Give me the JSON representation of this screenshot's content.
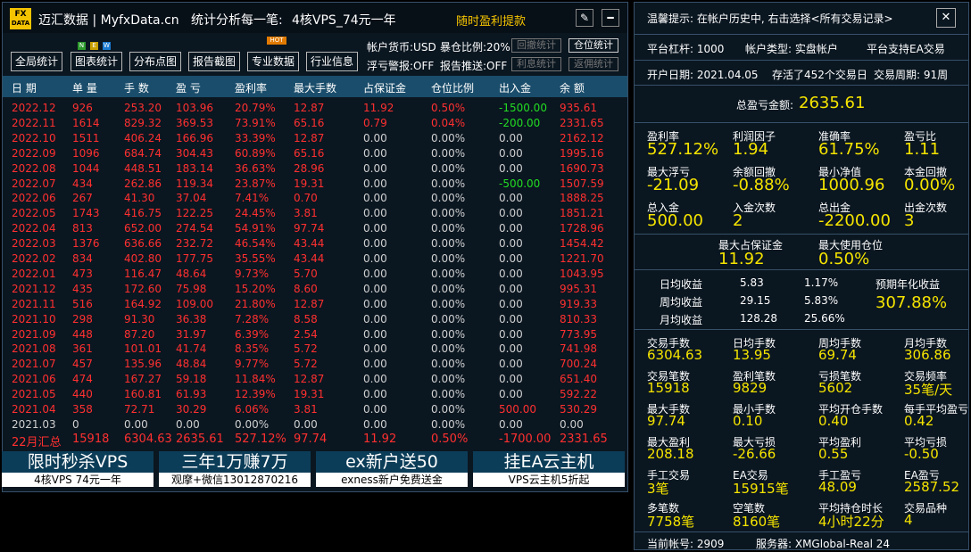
{
  "header": {
    "logo_top": "FX",
    "logo_bottom": "DATA",
    "title": "迈汇数据 | MyfxData.cn",
    "subtitle": "统计分析每一笔:",
    "vps": "4核VPS_74元一年",
    "promo": "随时盈利提款",
    "min_icon": "pen-icon",
    "max_icon": "minus-icon"
  },
  "toolbar": {
    "buttons": [
      "全局统计",
      "图表统计",
      "分布点图",
      "报告截图",
      "专业数据",
      "行业信息"
    ],
    "badge_new": [
      "N",
      "E",
      "W"
    ],
    "badge_hot": "HOT",
    "info_currency": "帐户货币:USD",
    "info_leverage": "暴仓比例:20%",
    "info_float": "浮亏警报:OFF",
    "info_push": "报告推送:OFF",
    "btn_drawdown": "回撤统计",
    "btn_position": "仓位统计",
    "btn_interest": "利息统计",
    "btn_rebate": "返佣统计"
  },
  "table": {
    "columns": [
      "日 期",
      "单 量",
      "手 数",
      "盈 亏",
      "盈利率",
      "最大手数",
      "占保证金",
      "仓位比例",
      "出入金",
      "余 额"
    ],
    "rows": [
      [
        "2022.12",
        "926",
        "253.20",
        "103.96",
        "20.79%",
        "12.87",
        "11.92",
        "0.50%",
        "-1500.00",
        "935.61"
      ],
      [
        "2022.11",
        "1614",
        "829.32",
        "369.53",
        "73.91%",
        "65.16",
        "0.79",
        "0.04%",
        "-200.00",
        "2331.65"
      ],
      [
        "2022.10",
        "1511",
        "406.24",
        "166.96",
        "33.39%",
        "12.87",
        "0.00",
        "0.00%",
        "0.00",
        "2162.12"
      ],
      [
        "2022.09",
        "1096",
        "684.74",
        "304.43",
        "60.89%",
        "65.16",
        "0.00",
        "0.00%",
        "0.00",
        "1995.16"
      ],
      [
        "2022.08",
        "1044",
        "448.51",
        "183.14",
        "36.63%",
        "28.96",
        "0.00",
        "0.00%",
        "0.00",
        "1690.73"
      ],
      [
        "2022.07",
        "434",
        "262.86",
        "119.34",
        "23.87%",
        "19.31",
        "0.00",
        "0.00%",
        "-500.00",
        "1507.59"
      ],
      [
        "2022.06",
        "267",
        "41.30",
        "37.04",
        "7.41%",
        "0.70",
        "0.00",
        "0.00%",
        "0.00",
        "1888.25"
      ],
      [
        "2022.05",
        "1743",
        "416.75",
        "122.25",
        "24.45%",
        "3.81",
        "0.00",
        "0.00%",
        "0.00",
        "1851.21"
      ],
      [
        "2022.04",
        "813",
        "652.00",
        "274.54",
        "54.91%",
        "97.74",
        "0.00",
        "0.00%",
        "0.00",
        "1728.96"
      ],
      [
        "2022.03",
        "1376",
        "636.66",
        "232.72",
        "46.54%",
        "43.44",
        "0.00",
        "0.00%",
        "0.00",
        "1454.42"
      ],
      [
        "2022.02",
        "834",
        "402.80",
        "177.75",
        "35.55%",
        "43.44",
        "0.00",
        "0.00%",
        "0.00",
        "1221.70"
      ],
      [
        "2022.01",
        "473",
        "116.47",
        "48.64",
        "9.73%",
        "5.70",
        "0.00",
        "0.00%",
        "0.00",
        "1043.95"
      ],
      [
        "2021.12",
        "435",
        "172.60",
        "75.98",
        "15.20%",
        "8.60",
        "0.00",
        "0.00%",
        "0.00",
        "995.31"
      ],
      [
        "2021.11",
        "516",
        "164.92",
        "109.00",
        "21.80%",
        "12.87",
        "0.00",
        "0.00%",
        "0.00",
        "919.33"
      ],
      [
        "2021.10",
        "298",
        "91.30",
        "36.38",
        "7.28%",
        "8.58",
        "0.00",
        "0.00%",
        "0.00",
        "810.33"
      ],
      [
        "2021.09",
        "448",
        "87.20",
        "31.97",
        "6.39%",
        "2.54",
        "0.00",
        "0.00%",
        "0.00",
        "773.95"
      ],
      [
        "2021.08",
        "361",
        "101.01",
        "41.74",
        "8.35%",
        "5.72",
        "0.00",
        "0.00%",
        "0.00",
        "741.98"
      ],
      [
        "2021.07",
        "457",
        "135.96",
        "48.84",
        "9.77%",
        "5.72",
        "0.00",
        "0.00%",
        "0.00",
        "700.24"
      ],
      [
        "2021.06",
        "474",
        "167.27",
        "59.18",
        "11.84%",
        "12.87",
        "0.00",
        "0.00%",
        "0.00",
        "651.40"
      ],
      [
        "2021.05",
        "440",
        "160.81",
        "61.93",
        "12.39%",
        "19.31",
        "0.00",
        "0.00%",
        "0.00",
        "592.22"
      ],
      [
        "2021.04",
        "358",
        "72.71",
        "30.29",
        "6.06%",
        "3.81",
        "0.00",
        "0.00%",
        "500.00",
        "530.29"
      ],
      [
        "2021.03",
        "0",
        "0.00",
        "0.00",
        "0.00%",
        "0.00",
        "0.00",
        "0.00%",
        "0.00",
        "0.00"
      ]
    ],
    "summary": [
      "22月汇总",
      "15918",
      "6304.63",
      "2635.61",
      "527.12%",
      "97.74",
      "11.92",
      "0.50%",
      "-1700.00",
      "2331.65"
    ],
    "colors": {
      "row": "#ff3030",
      "zero_row": "#d0d0d0",
      "neg_cash": "#22dd22",
      "pos_cash": "#ff3030"
    }
  },
  "banners": [
    {
      "big": "限时秒杀VPS",
      "small": "4核VPS  74元一年"
    },
    {
      "big": "三年1万赚7万",
      "small": "观摩+微信13012870216"
    },
    {
      "big": "ex新户送50",
      "small": "exness新户免费送金"
    },
    {
      "big": "挂EA云主机",
      "small": "VPS云主机5折起"
    }
  ],
  "panel": {
    "tip": "温馨提示: 在帐户历史中, 右击选择<所有交易记录>",
    "close_icon": "close-icon",
    "leverage": "平台杠杆: 1000",
    "account_type": "帐户类型: 实盘帐户",
    "ea_support": "平台支持EA交易",
    "open_date": "开户日期: 2021.04.05",
    "days": "存活了452个交易日",
    "cycle": "交易周期: 91周",
    "total_label": "总盈亏金额:",
    "total_value": "2635.61",
    "stats1": [
      {
        "label": "盈利率",
        "value": "527.12%"
      },
      {
        "label": "利润因子",
        "value": "1.94"
      },
      {
        "label": "准确率",
        "value": "61.75%"
      },
      {
        "label": "盈亏比",
        "value": "1.11"
      },
      {
        "label": "最大浮亏",
        "value": "-21.09"
      },
      {
        "label": "余额回撤",
        "value": "-0.88%"
      },
      {
        "label": "最小净值",
        "value": "1000.96"
      },
      {
        "label": "本金回撤",
        "value": "0.00%"
      },
      {
        "label": "总入金",
        "value": "500.00"
      },
      {
        "label": "入金次数",
        "value": "2"
      },
      {
        "label": "总出金",
        "value": "-2200.00"
      },
      {
        "label": "出金次数",
        "value": "3"
      }
    ],
    "margin_label": "最大占保证金",
    "margin_value": "11.92",
    "pos_label": "最大使用仓位",
    "pos_value": "0.50%",
    "returns": [
      {
        "label": "日均收益",
        "value": "5.83",
        "pct": "1.17%"
      },
      {
        "label": "周均收益",
        "value": "29.15",
        "pct": "5.83%"
      },
      {
        "label": "月均收益",
        "value": "128.28",
        "pct": "25.66%"
      }
    ],
    "annual_label": "预期年化收益",
    "annual_value": "307.88%",
    "stats2": [
      {
        "label": "交易手数",
        "value": "6304.63"
      },
      {
        "label": "日均手数",
        "value": "13.95"
      },
      {
        "label": "周均手数",
        "value": "69.74"
      },
      {
        "label": "月均手数",
        "value": "306.86"
      },
      {
        "label": "交易笔数",
        "value": "15918"
      },
      {
        "label": "盈利笔数",
        "value": "9829"
      },
      {
        "label": "亏损笔数",
        "value": "5602"
      },
      {
        "label": "交易频率",
        "value": "35笔/天"
      },
      {
        "label": "最大手数",
        "value": "97.74"
      },
      {
        "label": "最小手数",
        "value": "0.10"
      },
      {
        "label": "平均开仓手数",
        "value": "0.40"
      },
      {
        "label": "每手平均盈亏",
        "value": "0.42"
      },
      {
        "label": "最大盈利",
        "value": "208.18"
      },
      {
        "label": "最大亏损",
        "value": "-26.66"
      },
      {
        "label": "平均盈利",
        "value": "0.55"
      },
      {
        "label": "平均亏损",
        "value": "-0.50"
      },
      {
        "label": "手工交易",
        "value": "3笔"
      },
      {
        "label": "EA交易",
        "value": "15915笔"
      },
      {
        "label": "手工盈亏",
        "value": "48.09"
      },
      {
        "label": "EA盈亏",
        "value": "2587.52"
      },
      {
        "label": "多笔数",
        "value": "7758笔"
      },
      {
        "label": "空笔数",
        "value": "8160笔"
      },
      {
        "label": "平均持仓时长",
        "value": "4小时22分"
      },
      {
        "label": "交易品种",
        "value": "4"
      }
    ],
    "account": "当前帐号: 2909",
    "server": "服务器: XMGlobal-Real 24"
  }
}
